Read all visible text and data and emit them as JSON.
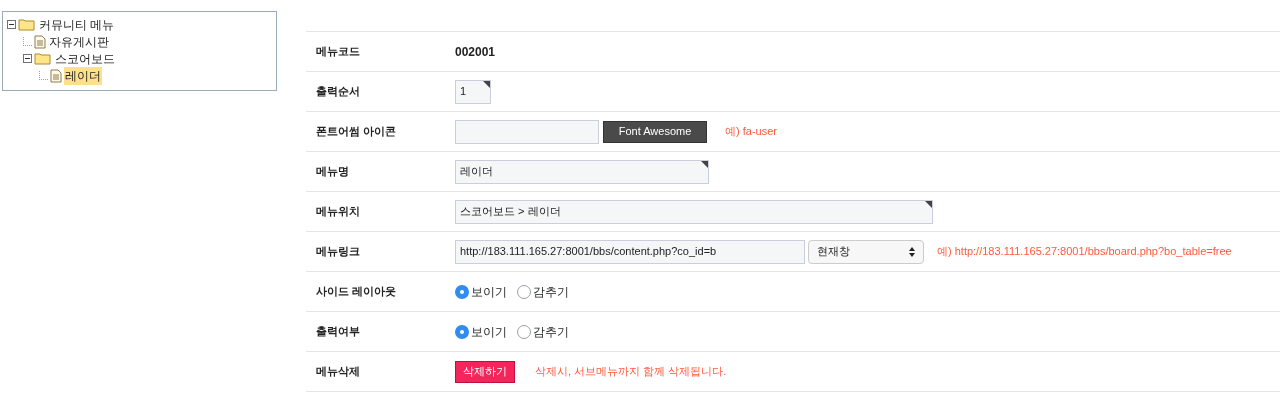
{
  "tree": [
    {
      "label": "커뮤니티 메뉴",
      "kind": "folder",
      "expanded": true,
      "selected": false,
      "children": [
        {
          "label": "자유게시판",
          "kind": "page",
          "selected": false
        },
        {
          "label": "스코어보드",
          "kind": "folder",
          "expanded": true,
          "selected": false,
          "children": [
            {
              "label": "레이더",
              "kind": "page",
              "selected": true
            }
          ]
        }
      ]
    }
  ],
  "form": [
    {
      "kind": "text",
      "label": "메뉴코드",
      "value": "002001"
    },
    {
      "kind": "short_input",
      "label": "출력순서",
      "value": "1"
    },
    {
      "kind": "icon",
      "label": "폰트어썸 아이콘",
      "button": "Font Awesome",
      "hint": "예) fa-user"
    },
    {
      "kind": "input",
      "label": "메뉴명",
      "value": "레이더"
    },
    {
      "kind": "wide_input",
      "label": "메뉴위치",
      "value": "스코어보드 > 레이더"
    },
    {
      "kind": "link",
      "label": "메뉴링크",
      "value": "http://183.111.165.27:8001/bbs/content.php?co_id=b",
      "select": "현재창",
      "hint": "예) http://183.111.165.27:8001/bbs/board.php?bo_table=free"
    },
    {
      "kind": "radio",
      "label": "사이드 레이아웃",
      "options": [
        {
          "label": "보이기",
          "selected": true
        },
        {
          "label": "감추기",
          "selected": false
        }
      ]
    },
    {
      "kind": "radio",
      "label": "출력여부",
      "options": [
        {
          "label": "보이기",
          "selected": true
        },
        {
          "label": "감추기",
          "selected": false
        }
      ]
    },
    {
      "kind": "delete",
      "label": "메뉴삭제",
      "button": "삭제하기",
      "hint": "삭제시, 서브메뉴까지 함께 삭제됩니다."
    }
  ]
}
